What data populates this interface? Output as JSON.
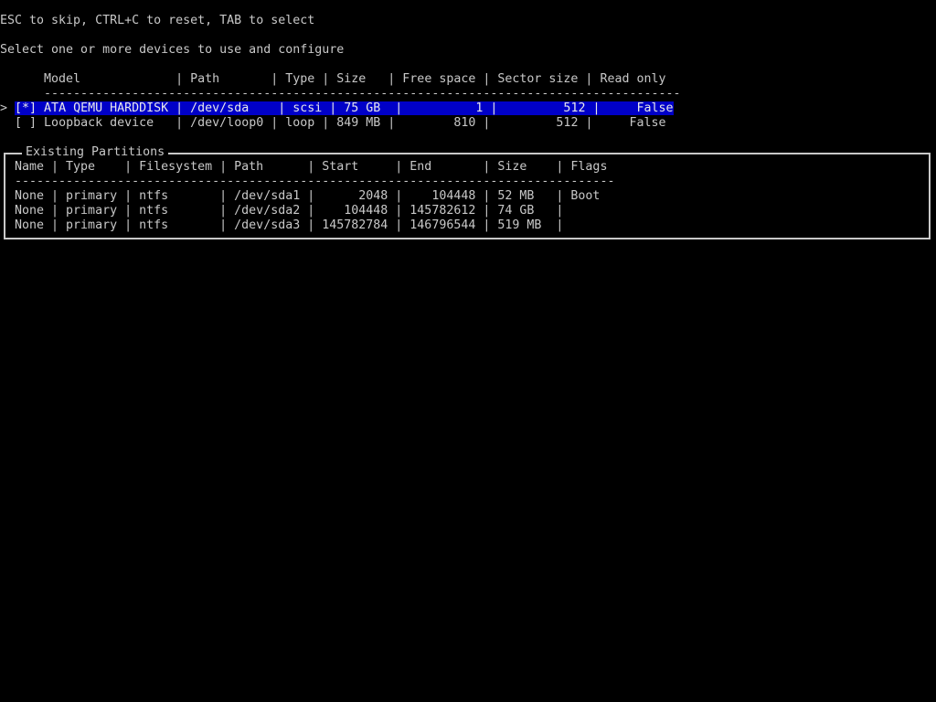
{
  "hints": "ESC to skip, CTRL+C to reset, TAB to select",
  "prompt": "Select one or more devices to use and configure",
  "devices": {
    "header": "      Model             | Path       | Type | Size   | Free space | Sector size | Read only",
    "separator": "      ---------------------------------------------------------------------------------------",
    "rows": [
      {
        "cursor": "> ",
        "checkbox": "[*]",
        "text": " ATA QEMU HARDDISK | /dev/sda    | scsi | 75 GB  |          1 |         512 |     False"
      },
      {
        "cursor": "  ",
        "checkbox": "[ ]",
        "text": " Loopback device   | /dev/loop0 | loop | 849 MB |        810 |         512 |     False"
      }
    ]
  },
  "partitions": {
    "title": "Existing Partitions",
    "header": " Name | Type    | Filesystem | Path      | Start     | End       | Size    | Flags",
    "separator": " ----------------------------------------------------------------------------------",
    "rows": [
      " None | primary | ntfs       | /dev/sda1 |      2048 |    104448 | 52 MB   | Boot",
      " None | primary | ntfs       | /dev/sda2 |    104448 | 145782612 | 74 GB   |",
      " None | primary | ntfs       | /dev/sda3 | 145782784 | 146796544 | 519 MB  |"
    ]
  },
  "colors": {
    "background": "#000000",
    "foreground": "#c8c8c8",
    "selection": "#0000c8"
  }
}
